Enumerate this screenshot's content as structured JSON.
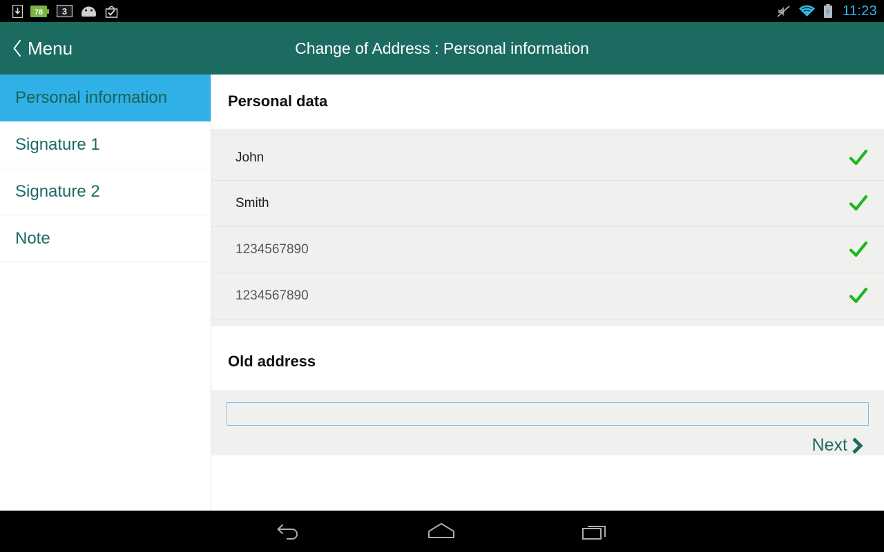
{
  "status_bar": {
    "left_icons": [
      {
        "name": "download-manager-icon",
        "label": "download"
      },
      {
        "name": "battery-percent-icon",
        "label": "78"
      },
      {
        "name": "screen-record-icon",
        "label": "3"
      },
      {
        "name": "android-robot-icon",
        "label": "android"
      },
      {
        "name": "app-install-icon",
        "label": "install"
      }
    ],
    "right_icons": [
      {
        "name": "mute-icon",
        "label": "muted"
      },
      {
        "name": "wifi-icon",
        "label": "wifi"
      },
      {
        "name": "battery-charging-icon",
        "label": "charging"
      }
    ],
    "time": "11:23",
    "clock_color": "#33b5e5"
  },
  "header": {
    "back_label": "Menu",
    "title": "Change of Address : Personal information",
    "background": "#1b6b61",
    "text_color": "#ffffff"
  },
  "sidebar": {
    "items": [
      {
        "label": "Personal information",
        "active": true
      },
      {
        "label": "Signature 1",
        "active": false
      },
      {
        "label": "Signature 2",
        "active": false
      },
      {
        "label": "Note",
        "active": false
      }
    ],
    "active_background": "#2fb0e6",
    "item_color": "#1b6b61"
  },
  "main": {
    "personal_data": {
      "title": "Personal data",
      "rows": [
        {
          "value": "John",
          "status": "valid",
          "muted": false
        },
        {
          "value": "Smith",
          "status": "valid",
          "muted": false
        },
        {
          "value": "1234567890",
          "status": "valid",
          "muted": true
        },
        {
          "value": "1234567890",
          "status": "valid",
          "muted": true
        }
      ],
      "check_color": "#1db81d"
    },
    "old_address": {
      "title": "Old address",
      "input_value": "",
      "input_placeholder": "",
      "input_border_color": "#74c4e8"
    },
    "next_button": {
      "label": "Next",
      "color": "#1b6b61"
    },
    "panel_background": "#f0f0ee"
  },
  "nav_bar": {
    "buttons": [
      {
        "name": "back-nav-button",
        "label": "Back"
      },
      {
        "name": "home-nav-button",
        "label": "Home"
      },
      {
        "name": "recent-apps-nav-button",
        "label": "Recent apps"
      }
    ]
  }
}
